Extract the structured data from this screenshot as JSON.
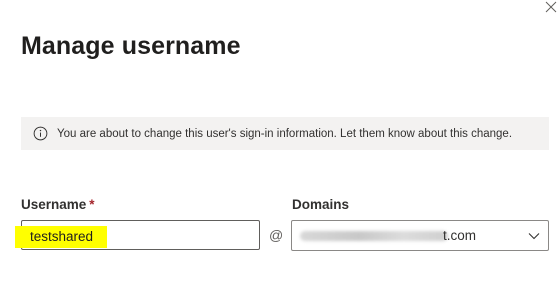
{
  "panel": {
    "title": "Manage username",
    "close_icon": "close-icon"
  },
  "info_bar": {
    "icon": "info-icon",
    "message": "You are about to change this user's sign-in information. Let them know about this change."
  },
  "form": {
    "username_label": "Username",
    "required_marker": "*",
    "username_value": "testshared",
    "username_highlight_color": "#ffff00",
    "at_symbol": "@",
    "domains_label": "Domains",
    "domain_value_visible": "t.com",
    "domain_chevron_icon": "chevron-down-icon"
  },
  "colors": {
    "info_background": "#f3f2f1",
    "required": "#a4262c",
    "text": "#201f1e"
  }
}
